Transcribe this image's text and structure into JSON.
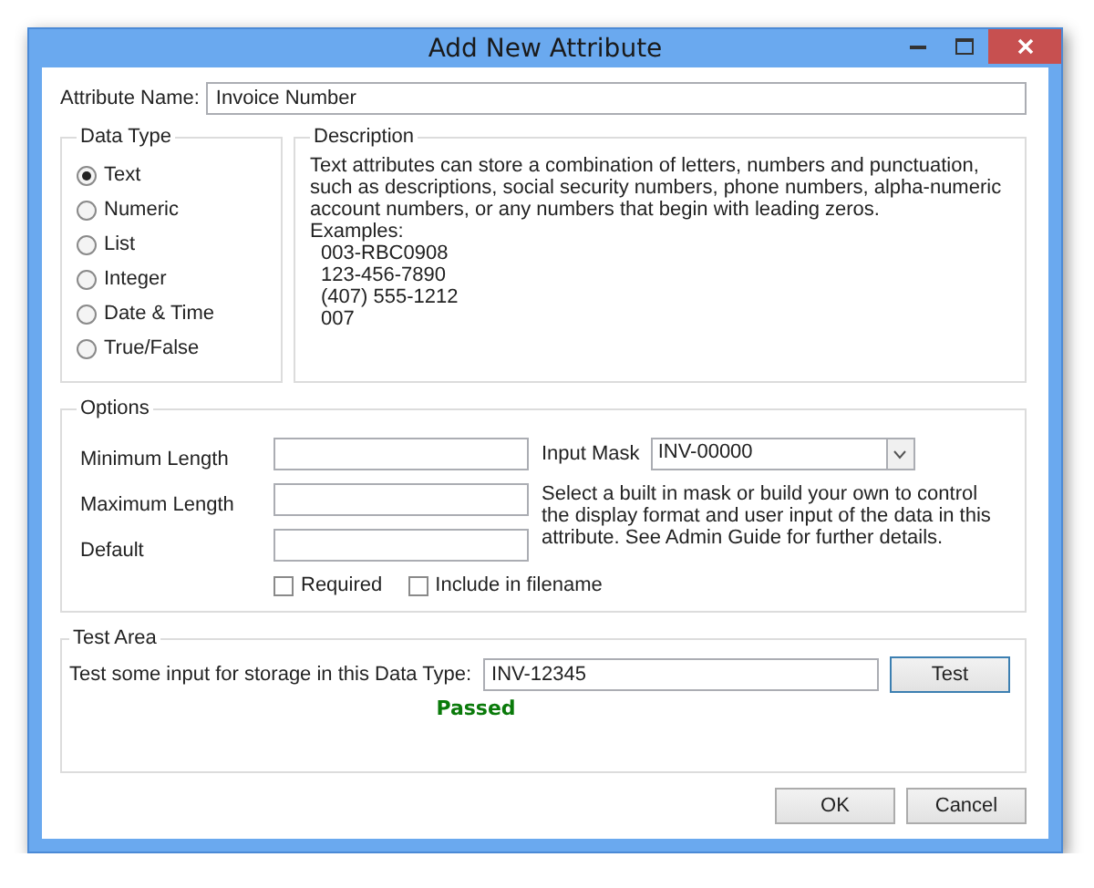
{
  "window": {
    "title": "Add New Attribute"
  },
  "attribute_name": {
    "label": "Attribute Name:",
    "value": "Invoice Number"
  },
  "data_type": {
    "title": "Data Type",
    "options": [
      {
        "label": "Text",
        "selected": true
      },
      {
        "label": "Numeric",
        "selected": false
      },
      {
        "label": "List",
        "selected": false
      },
      {
        "label": "Integer",
        "selected": false
      },
      {
        "label": "Date & Time",
        "selected": false
      },
      {
        "label": "True/False",
        "selected": false
      }
    ]
  },
  "description": {
    "title": "Description",
    "text": "Text attributes can store a combination of letters, numbers and punctuation, such as descriptions, social security numbers, phone numbers, alpha-numeric account numbers, or any numbers that begin with leading zeros.",
    "examples_label": "Examples:",
    "examples": [
      "003-RBC0908",
      "123-456-7890",
      "(407) 555-1212",
      "007"
    ]
  },
  "options": {
    "title": "Options",
    "fields": [
      {
        "label": "Minimum Length"
      },
      {
        "label": "Maximum Length"
      },
      {
        "label": "Default"
      }
    ],
    "input_mask": {
      "label": "Input Mask",
      "value": "INV-00000"
    },
    "mask_help": "Select a built in mask or build your own to control the display format and user input of the data in this attribute.  See Admin Guide for further details.",
    "checkboxes": [
      {
        "label": "Required",
        "checked": false
      },
      {
        "label": "Include in filename",
        "checked": false
      }
    ]
  },
  "test_area": {
    "title": "Test Area",
    "label": "Test some input for storage in this Data Type:",
    "value": "INV-12345",
    "button": "Test",
    "result": "Passed"
  },
  "buttons": [
    "OK",
    "Cancel"
  ]
}
